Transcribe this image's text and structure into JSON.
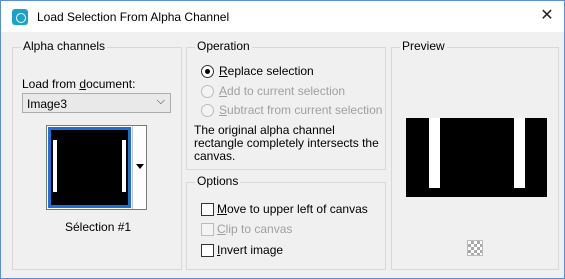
{
  "window": {
    "title": "Load Selection From Alpha Channel",
    "close_glyph": "✕"
  },
  "alpha_channels": {
    "group_title": "Alpha channels",
    "load_from_label_prefix": "Load from ",
    "load_from_label_underlined": "d",
    "load_from_label_suffix": "ocument:",
    "document_value": "Image3",
    "selection_name": "Sélection #1"
  },
  "operation": {
    "group_title": "Operation",
    "options": [
      {
        "u": "R",
        "rest": "eplace selection",
        "selected": true,
        "enabled": true
      },
      {
        "u": "A",
        "rest": "dd to current selection",
        "selected": false,
        "enabled": false
      },
      {
        "u": "S",
        "rest": "ubtract from current selection",
        "selected": false,
        "enabled": false
      }
    ],
    "description": "The original alpha channel rectangle completely intersects the canvas."
  },
  "options": {
    "group_title": "Options",
    "items": [
      {
        "u": "M",
        "rest": "ove to upper left of canvas",
        "checked": false,
        "enabled": true
      },
      {
        "u": "C",
        "rest": "lip to canvas",
        "checked": false,
        "enabled": false
      },
      {
        "u": "I",
        "rest": "nvert image",
        "checked": false,
        "enabled": true
      }
    ]
  },
  "preview": {
    "group_title": "Preview",
    "icon": "checkerboard-icon"
  },
  "colors": {
    "selection_border": "#1e6fd6",
    "window_border": "#5a8fd8",
    "app_icon": "#1aa3c9"
  }
}
